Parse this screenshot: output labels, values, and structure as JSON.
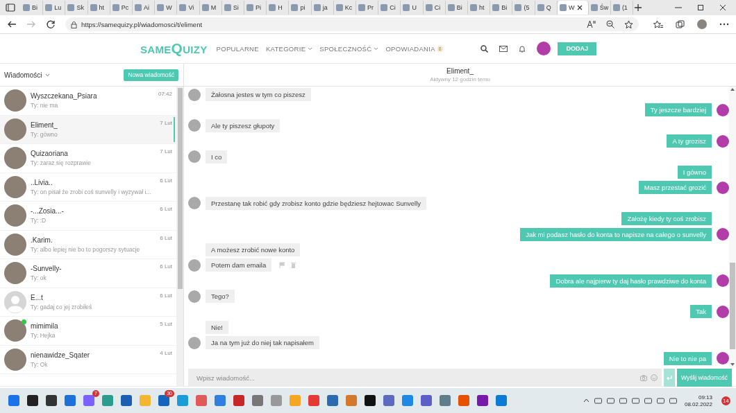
{
  "browser": {
    "tabs": [
      {
        "label": "Bi",
        "selected": false
      },
      {
        "label": "Lu",
        "selected": false
      },
      {
        "label": "Sk",
        "selected": false
      },
      {
        "label": "ht",
        "selected": false
      },
      {
        "label": "Pc",
        "selected": false
      },
      {
        "label": "Ai",
        "selected": false
      },
      {
        "label": "W",
        "selected": false
      },
      {
        "label": "Vi",
        "selected": false
      },
      {
        "label": "M",
        "selected": false
      },
      {
        "label": "Si",
        "selected": false
      },
      {
        "label": "Pi",
        "selected": false
      },
      {
        "label": "H",
        "selected": false
      },
      {
        "label": "pi",
        "selected": false
      },
      {
        "label": "ja",
        "selected": false
      },
      {
        "label": "Kc",
        "selected": false
      },
      {
        "label": "Pr",
        "selected": false
      },
      {
        "label": "Ci",
        "selected": false
      },
      {
        "label": "U",
        "selected": false
      },
      {
        "label": "Ci",
        "selected": false
      },
      {
        "label": "Bi",
        "selected": false
      },
      {
        "label": "ht",
        "selected": false
      },
      {
        "label": "Bi",
        "selected": false
      },
      {
        "label": "(5",
        "selected": false
      },
      {
        "label": "Q",
        "selected": false
      },
      {
        "label": "W",
        "selected": true
      },
      {
        "label": "Św",
        "selected": false
      },
      {
        "label": "(1",
        "selected": false
      }
    ],
    "url": "https://samequizy.pl/wiadomosci/t/eliment"
  },
  "site_header": {
    "logo_first": "SAME",
    "logo_second": "QUIZY",
    "nav": [
      {
        "label": "POPULARNE",
        "dropdown": false
      },
      {
        "label": "KATEGORIE",
        "dropdown": true
      },
      {
        "label": "SPOŁECZNOŚĆ",
        "dropdown": true
      },
      {
        "label": "OPOWIADANIA",
        "dropdown": false,
        "badge": "8"
      }
    ],
    "add_button": "DODAJ"
  },
  "sidebar": {
    "title": "Wiadomości",
    "new_button": "Nowa wiadomość",
    "conversations": [
      {
        "name": "Wyszczekana_Psiara",
        "preview": "Ty: nie ma",
        "time": "07:42",
        "kind": "photo",
        "online": false,
        "selected": false
      },
      {
        "name": "Eliment_",
        "preview": "Ty: gówno",
        "time": "7 Lut",
        "kind": "photo",
        "online": false,
        "selected": true
      },
      {
        "name": "Quizaoriana",
        "preview": "Ty: zaraz się rozprawie",
        "time": "7 Lut",
        "kind": "photo",
        "online": false,
        "selected": false
      },
      {
        "name": "..Livia..",
        "preview": "Ty: on pisał że zrobi coś sunvelly i wyzywał i...",
        "time": "6 Lut",
        "kind": "photo",
        "online": false,
        "selected": false
      },
      {
        "name": "-...Zosia...-",
        "preview": "Ty: :D",
        "time": "6 Lut",
        "kind": "photo",
        "online": false,
        "selected": false
      },
      {
        "name": ".Karim.",
        "preview": "Ty: albo lepiej nie bo to pogorszy sytuacje",
        "time": "6 Lut",
        "kind": "photo",
        "online": false,
        "selected": false
      },
      {
        "name": "-Sunvelly-",
        "preview": "Ty: ok",
        "time": "6 Lut",
        "kind": "photo",
        "online": false,
        "selected": false
      },
      {
        "name": "E...t",
        "preview": "Ty: gadaj co jej zrobiłeś",
        "time": "6 Lut",
        "kind": "default",
        "online": false,
        "selected": false
      },
      {
        "name": "mimimila",
        "preview": "Ty: Hejka",
        "time": "5 Lut",
        "kind": "photo",
        "online": true,
        "selected": false
      },
      {
        "name": "nienawidze_Sqater",
        "preview": "Ty: Ok",
        "time": "4 Lut",
        "kind": "photo",
        "online": false,
        "selected": false
      }
    ]
  },
  "chat": {
    "name": "Eliment_",
    "status": "Aktywny 12 godzin temu",
    "messages": [
      {
        "kind": "in",
        "text": "Żałosna jestes w tym co piszesz",
        "avatar": true,
        "actions": false
      },
      {
        "kind": "out",
        "text": "Ty jeszcze bardziej",
        "avatar": true,
        "actions": false
      },
      {
        "kind": "in",
        "text": "Ale ty piszesz głupoty",
        "avatar": true,
        "actions": false
      },
      {
        "kind": "out",
        "text": "A ty grozisz",
        "avatar": true,
        "actions": false
      },
      {
        "kind": "in",
        "text": "I co",
        "avatar": true,
        "actions": false
      },
      {
        "kind": "out",
        "text": "I gówno",
        "avatar": false,
        "actions": false
      },
      {
        "kind": "out",
        "text": "Masz przestać grozić",
        "avatar": true,
        "actions": false
      },
      {
        "kind": "in",
        "text": "Przestanę tak robić gdy zrobisz konto gdzie będziesz hejtowac Sunvelly",
        "avatar": true,
        "actions": false
      },
      {
        "kind": "out",
        "text": "Założę kiedy ty coś zrobisz",
        "avatar": false,
        "actions": false
      },
      {
        "kind": "out",
        "text": "Jak mi podasz hasło do konta to napisze na całego o sunvelly",
        "avatar": true,
        "actions": false
      },
      {
        "kind": "in",
        "text": "A możesz zrobić nowe konto",
        "avatar": false,
        "actions": false
      },
      {
        "kind": "in",
        "text": "Potem dam emaila",
        "avatar": true,
        "actions": true
      },
      {
        "kind": "out",
        "text": "Dobra ale najpierw ty daj hasło prawdziwe do konta",
        "avatar": true,
        "actions": false
      },
      {
        "kind": "in",
        "text": "Tego?",
        "avatar": true,
        "actions": false
      },
      {
        "kind": "out",
        "text": "Tak",
        "avatar": true,
        "actions": false
      },
      {
        "kind": "in",
        "text": "Nie!",
        "avatar": false,
        "actions": false
      },
      {
        "kind": "in",
        "text": "Ja na tym już do niej tak napisałem",
        "avatar": true,
        "actions": false
      },
      {
        "kind": "out",
        "text": "Nie to nie pa",
        "avatar": true,
        "actions": false
      }
    ],
    "input_placeholder": "Wpisz wiadomość...",
    "send_button": "Wyślij wiadomość"
  },
  "taskbar": {
    "chat_badge": "7",
    "mail_badge": "30",
    "time": "09:13",
    "date": "08.02.2022",
    "notifications": "14"
  }
}
